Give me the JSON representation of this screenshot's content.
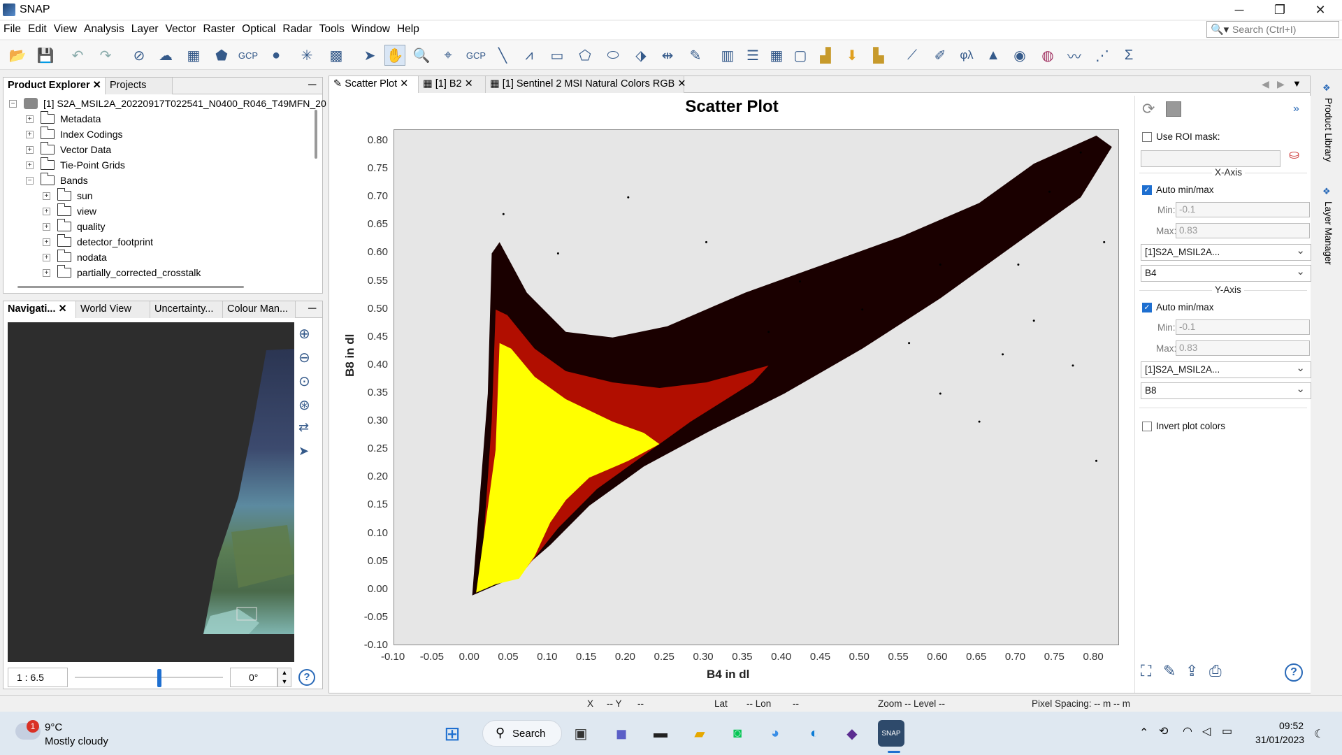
{
  "window": {
    "title": "SNAP",
    "minimize": "─",
    "restore": "❐",
    "close": "✕"
  },
  "menu": [
    "File",
    "Edit",
    "View",
    "Analysis",
    "Layer",
    "Vector",
    "Raster",
    "Optical",
    "Radar",
    "Tools",
    "Window",
    "Help"
  ],
  "search": {
    "placeholder": "Search (Ctrl+I)"
  },
  "product_explorer": {
    "tabs": [
      "Product Explorer",
      "Projects"
    ],
    "root": "[1] S2A_MSIL2A_20220917T022541_N0400_R046_T49MFN_20",
    "items": [
      "Metadata",
      "Index Codings",
      "Vector Data",
      "Tie-Point Grids",
      "Bands"
    ],
    "bands": [
      "sun",
      "view",
      "quality",
      "detector_footprint",
      "nodata",
      "partially_corrected_crosstalk"
    ]
  },
  "navigation": {
    "tabs": [
      "Navigati...",
      "World View",
      "Uncertainty...",
      "Colour Man..."
    ],
    "scale": "1 : 6.5",
    "rotation": "0°",
    "help": "?"
  },
  "editor_tabs": [
    "Scatter Plot",
    "[1] B2",
    "[1] Sentinel 2 MSI Natural Colors RGB"
  ],
  "chart_data": {
    "type": "scatter",
    "title": "Scatter Plot",
    "xlabel": "B4 in dl",
    "ylabel": "B8 in dl",
    "xlim": [
      -0.1,
      0.83
    ],
    "ylim": [
      -0.1,
      0.82
    ],
    "x_ticks": [
      "-0.10",
      "-0.05",
      "0.00",
      "0.05",
      "0.10",
      "0.15",
      "0.20",
      "0.25",
      "0.30",
      "0.35",
      "0.40",
      "0.45",
      "0.50",
      "0.55",
      "0.60",
      "0.65",
      "0.70",
      "0.75",
      "0.80"
    ],
    "y_ticks": [
      "0.80",
      "0.75",
      "0.70",
      "0.65",
      "0.60",
      "0.55",
      "0.50",
      "0.45",
      "0.40",
      "0.35",
      "0.30",
      "0.25",
      "0.20",
      "0.15",
      "0.10",
      "0.05",
      "0.00",
      "-0.05",
      "-0.10"
    ],
    "density_colors": {
      "low": "#1a0000",
      "mid": "#cc1100",
      "high": "#ffff00"
    },
    "background": "#e6e6e6"
  },
  "side_panel": {
    "use_roi_mask": "Use ROI mask:",
    "x_axis": {
      "title": "X-Axis",
      "auto": "Auto min/max",
      "min_label": "Min:",
      "min": "-0.1",
      "max_label": "Max:",
      "max": "0.83",
      "product": "[1]S2A_MSIL2A...",
      "band": "B4"
    },
    "y_axis": {
      "title": "Y-Axis",
      "auto": "Auto min/max",
      "min_label": "Min:",
      "min": "-0.1",
      "max_label": "Max:",
      "max": "0.83",
      "product": "[1]S2A_MSIL2A...",
      "band": "B8"
    },
    "invert": "Invert plot colors",
    "help": "?"
  },
  "right_strip": [
    "Product Library",
    "Layer Manager"
  ],
  "status": {
    "x": "X",
    "x_val": "-- Y",
    "y_val": "--",
    "lat": "Lat",
    "lat_val": "-- Lon",
    "lon_val": "--",
    "zoom": "Zoom -- Level --",
    "spacing": "Pixel Spacing: -- m -- m"
  },
  "taskbar": {
    "weather_temp": "9°C",
    "weather_desc": "Mostly cloudy",
    "badge": "1",
    "search": "Search",
    "time": "09:52",
    "date": "31/01/2023"
  },
  "colors": {
    "accent": "#1e6fd0"
  }
}
